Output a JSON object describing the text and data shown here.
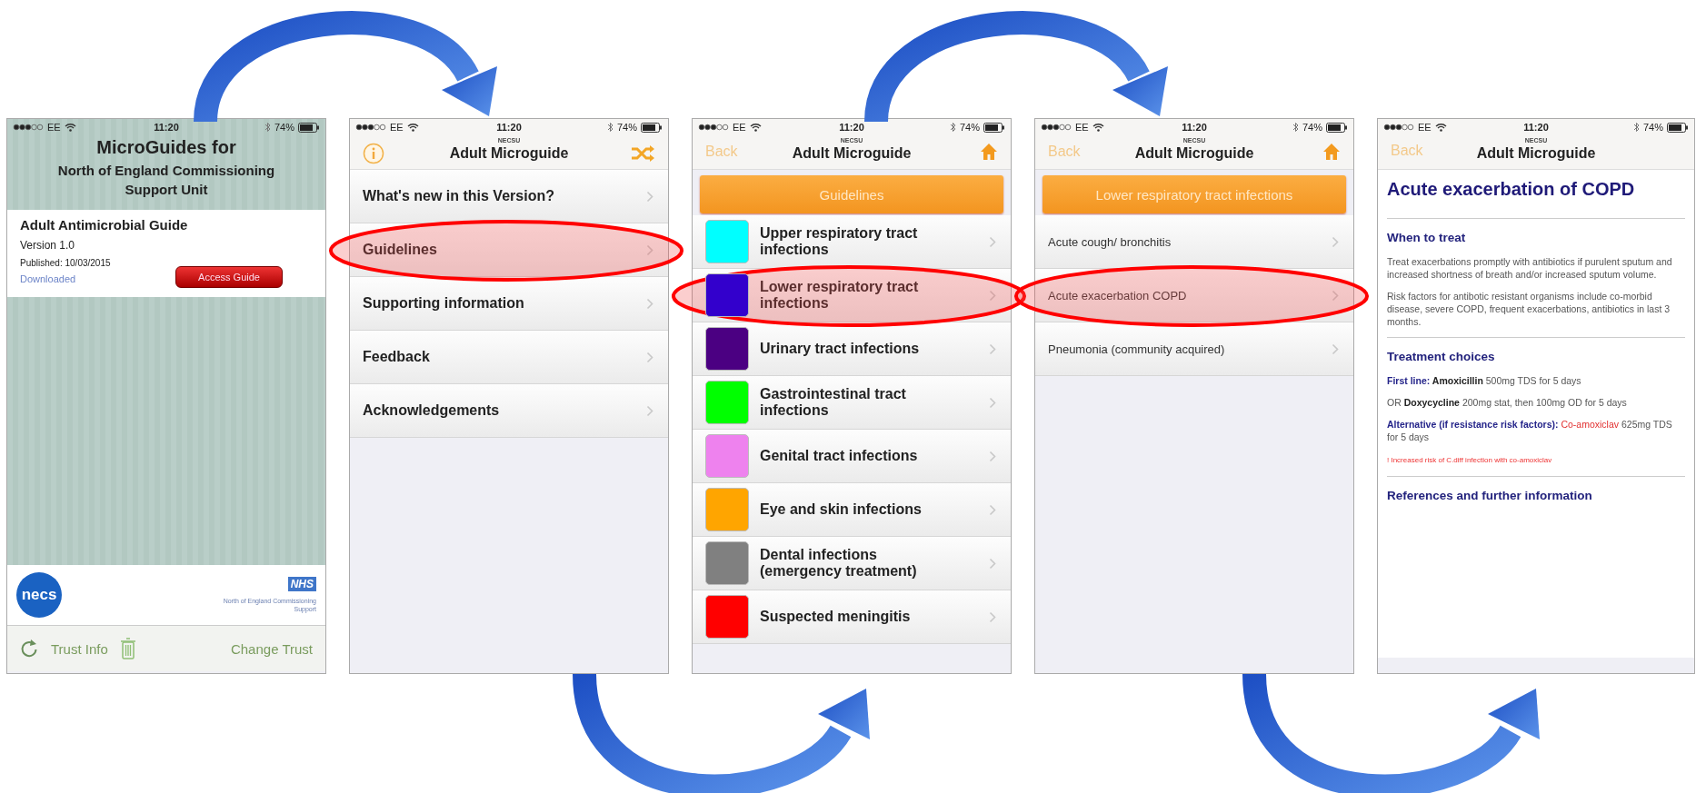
{
  "screens": [
    {
      "kind": "home",
      "status_bar": {
        "carrier": "EE",
        "time": "11:20",
        "battery": "74%"
      },
      "header": {
        "title": "MicroGuides for",
        "subtitle": "North of England Commissioning Support Unit"
      },
      "guide": {
        "name": "Adult Antimicrobial Guide",
        "version": "Version 1.0",
        "published": "Published: 10/03/2015",
        "status": "Downloaded",
        "button": "Access Guide"
      },
      "logos": {
        "necs": "necs",
        "nhs": "NHS",
        "nhs_caption": "North of England Commissioning Support"
      },
      "toolbar": [
        {
          "kind": "refresh"
        },
        {
          "kind": "label",
          "label": "Trust Info"
        },
        {
          "kind": "trash"
        },
        {
          "kind": "label",
          "label": "Change Trust"
        }
      ]
    },
    {
      "kind": "menu",
      "status_bar": {
        "carrier": "EE",
        "time": "11:20",
        "battery": "74%"
      },
      "nav": {
        "subtitle": "NECSU",
        "title": "Adult Microguide",
        "left": {
          "kind": "info"
        },
        "right": {
          "kind": "shuffle"
        }
      },
      "items": [
        {
          "label": "What's new in this Version?",
          "circled": false
        },
        {
          "label": "Guidelines",
          "circled": true
        },
        {
          "label": "Supporting information",
          "circled": false
        },
        {
          "label": "Feedback",
          "circled": false
        },
        {
          "label": "Acknowledgements",
          "circled": false
        }
      ]
    },
    {
      "kind": "categories",
      "status_bar": {
        "carrier": "EE",
        "time": "11:20",
        "battery": "74%"
      },
      "nav": {
        "subtitle": "NECSU",
        "title": "Adult Microguide",
        "left": {
          "kind": "back",
          "label": "Back"
        },
        "right": {
          "kind": "home"
        }
      },
      "header": "Guidelines",
      "items": [
        {
          "label": "Upper respiratory tract infections",
          "color": "#00ffff",
          "circled": false
        },
        {
          "label": "Lower respiratory tract infections",
          "color": "#3300cc",
          "circled": true
        },
        {
          "label": "Urinary tract infections",
          "color": "#4b0082",
          "circled": false
        },
        {
          "label": "Gastrointestinal tract infections",
          "color": "#00ff00",
          "circled": false
        },
        {
          "label": "Genital tract infections",
          "color": "#ee82ee",
          "circled": false
        },
        {
          "label": "Eye and skin infections",
          "color": "#ffa500",
          "circled": false
        },
        {
          "label": "Dental infections (emergency treatment)",
          "color": "#808080",
          "circled": false
        },
        {
          "label": "Suspected meningitis",
          "color": "#ff0000",
          "circled": false
        }
      ]
    },
    {
      "kind": "topics",
      "status_bar": {
        "carrier": "EE",
        "time": "11:20",
        "battery": "74%"
      },
      "nav": {
        "subtitle": "NECSU",
        "title": "Adult Microguide",
        "left": {
          "kind": "back",
          "label": "Back"
        },
        "right": {
          "kind": "home"
        }
      },
      "header": "Lower respiratory tract infections",
      "items": [
        {
          "label": "Acute cough/ bronchitis",
          "circled": false
        },
        {
          "label": "Acute exacerbation COPD",
          "circled": true
        },
        {
          "label": "Pneumonia (community acquired)",
          "circled": false
        }
      ]
    },
    {
      "kind": "article",
      "status_bar": {
        "carrier": "EE",
        "time": "11:20",
        "battery": "74%"
      },
      "nav": {
        "subtitle": "NECSU",
        "title": "Adult Microguide",
        "left": {
          "kind": "back",
          "label": "Back"
        }
      },
      "title": "Acute exacerbation of COPD",
      "sections": [
        {
          "heading": "When to treat",
          "paragraphs": [
            {
              "runs": [
                {
                  "kind": "plain",
                  "text": "Treat exacerbations promptly with antibiotics if purulent sputum and increased shortness of breath and/or increased sputum volume."
                }
              ]
            },
            {
              "runs": [
                {
                  "kind": "plain",
                  "text": "Risk factors for antibotic resistant organisms include co-morbid disease, severe COPD, frequent exacerbations, antibiotics in last 3 months."
                }
              ]
            }
          ]
        },
        {
          "heading": "Treatment choices",
          "paragraphs": [
            {
              "runs": [
                {
                  "kind": "label",
                  "text": "First line:"
                },
                {
                  "kind": "drug",
                  "text": "  Amoxicillin"
                },
                {
                  "kind": "plain",
                  "text": " 500mg TDS for 5 days"
                }
              ]
            },
            {
              "runs": [
                {
                  "kind": "plain",
                  "text": "OR "
                },
                {
                  "kind": "drug",
                  "text": "Doxycycline"
                },
                {
                  "kind": "plain",
                  "text": " 200mg stat, then 100mg OD for 5 days"
                }
              ]
            },
            {
              "runs": [
                {
                  "kind": "label",
                  "text": "Alternative (if resistance risk factors):"
                },
                {
                  "kind": "alert-drug",
                  "text": " Co-amoxiclav"
                },
                {
                  "kind": "plain",
                  "text": " 625mg TDS for 5 days"
                }
              ]
            },
            {
              "runs": [
                {
                  "kind": "warning",
                  "text": "! Increased risk of C.diff infection with co-amoxiclav"
                }
              ]
            }
          ]
        },
        {
          "heading": "References and further information"
        }
      ]
    }
  ]
}
